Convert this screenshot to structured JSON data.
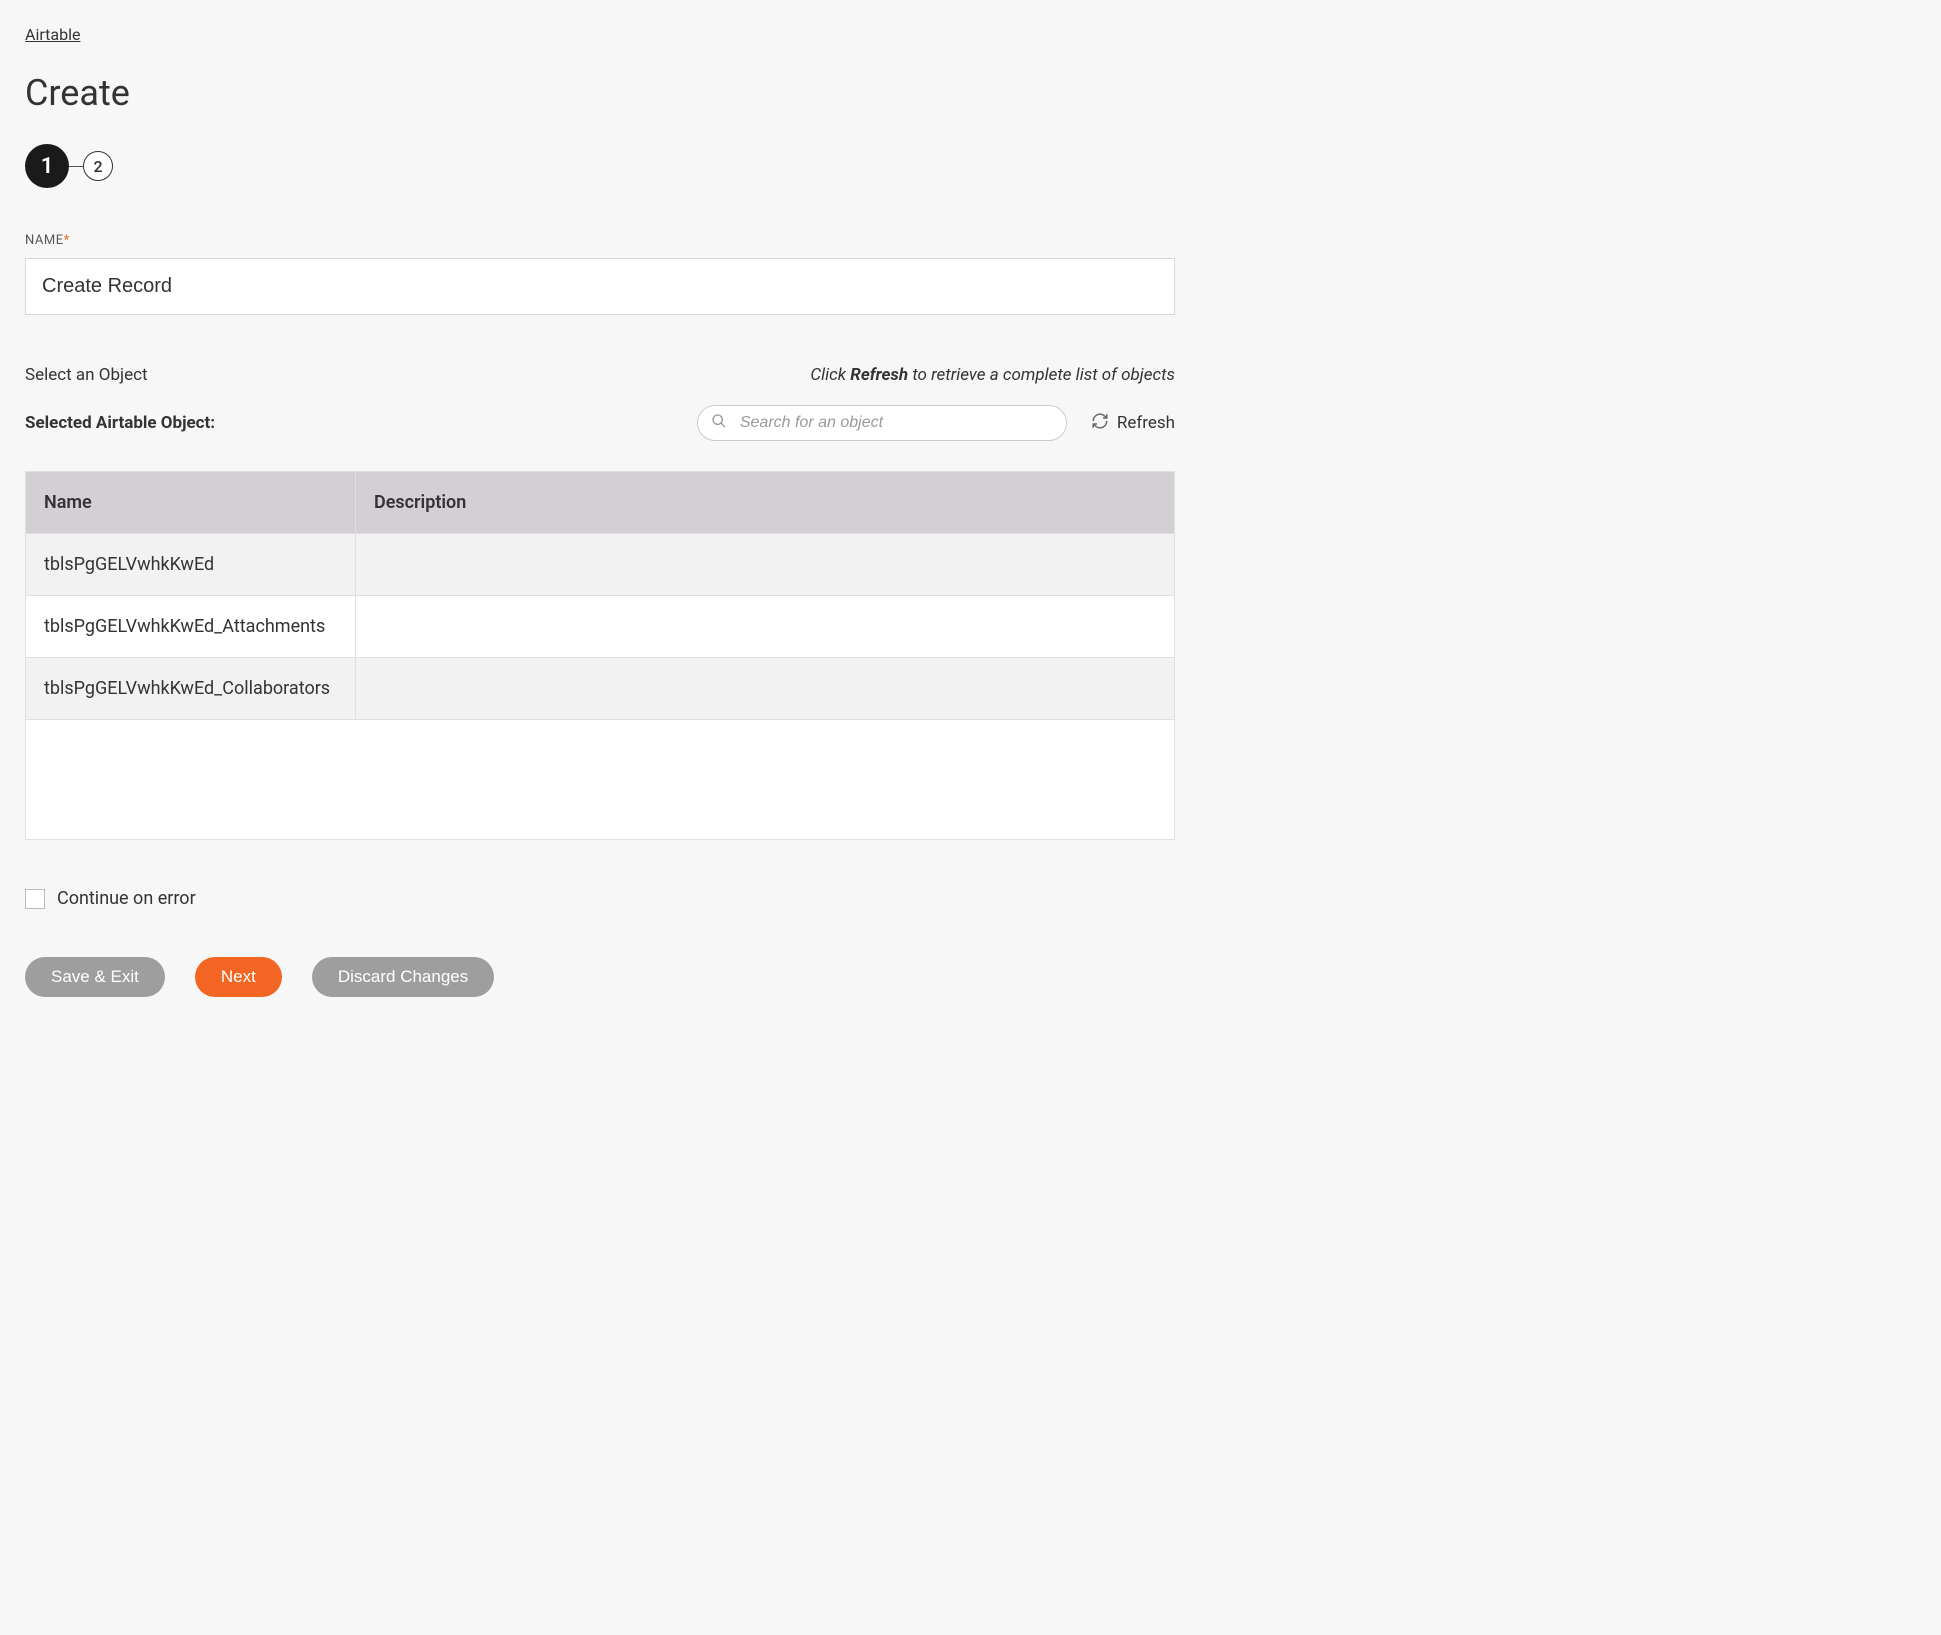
{
  "breadcrumb": {
    "label": "Airtable"
  },
  "page": {
    "title": "Create"
  },
  "stepper": {
    "steps": [
      "1",
      "2"
    ],
    "active_index": 0
  },
  "name_field": {
    "label": "NAME",
    "required_marker": "*",
    "value": "Create Record"
  },
  "object_section": {
    "select_label": "Select an Object",
    "hint_prefix": "Click ",
    "hint_strong": "Refresh",
    "hint_suffix": " to retrieve a complete list of objects",
    "selected_label": "Selected Airtable Object:",
    "search_placeholder": "Search for an object",
    "refresh_label": "Refresh"
  },
  "table": {
    "columns": [
      "Name",
      "Description"
    ],
    "rows": [
      {
        "name": "tblsPgGELVwhkKwEd",
        "description": ""
      },
      {
        "name": "tblsPgGELVwhkKwEd_Attachments",
        "description": ""
      },
      {
        "name": "tblsPgGELVwhkKwEd_Collaborators",
        "description": ""
      }
    ]
  },
  "continue_on_error": {
    "label": "Continue on error",
    "checked": false
  },
  "buttons": {
    "save_exit": "Save & Exit",
    "next": "Next",
    "discard": "Discard Changes"
  }
}
